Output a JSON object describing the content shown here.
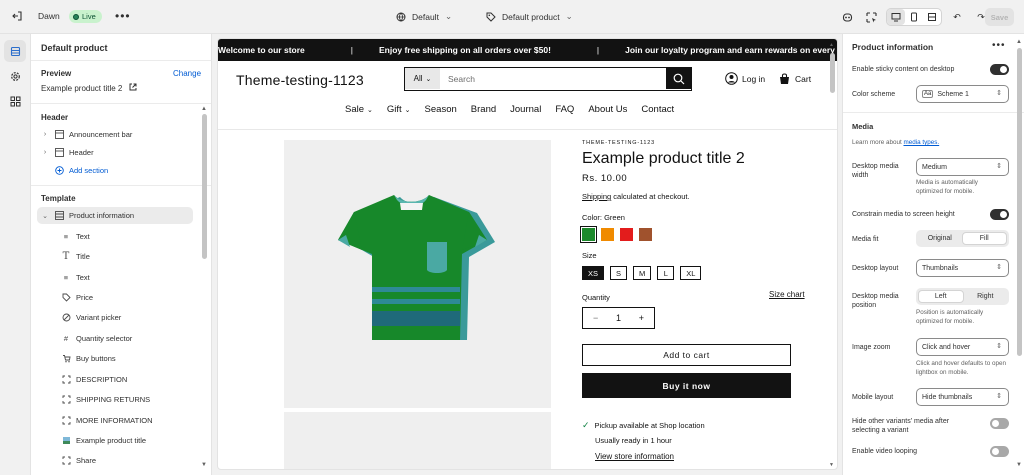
{
  "topbar": {
    "theme_name": "Dawn",
    "live_label": "Live",
    "more": "•••",
    "template_select": "Default",
    "product_select": "Default product",
    "save_label": "Save"
  },
  "left_panel": {
    "title": "Default product",
    "preview_label": "Preview",
    "change_label": "Change",
    "preview_value": "Example product title 2",
    "header_section": "Header",
    "header_items": [
      "Announcement bar",
      "Header"
    ],
    "add_section": "Add section",
    "template_section": "Template",
    "template_item": "Product information",
    "blocks": [
      "Text",
      "Title",
      "Text",
      "Price",
      "Variant picker",
      "Quantity selector",
      "Buy buttons",
      "DESCRIPTION",
      "SHIPPING RETURNS",
      "MORE INFORMATION",
      "Example product title",
      "Share"
    ]
  },
  "store": {
    "announcements": [
      "Welcome to our store",
      "Enjoy free shipping on all orders over $50!",
      "Join our loyalty program and earn rewards on every"
    ],
    "name": "Theme-testing-1123",
    "search_category": "All",
    "search_placeholder": "Search",
    "login": "Log in",
    "cart": "Cart",
    "nav": [
      "Sale",
      "Gift",
      "Season",
      "Brand",
      "Journal",
      "FAQ",
      "About Us",
      "Contact"
    ]
  },
  "product": {
    "vendor": "THEME-TESTING-1123",
    "title": "Example product title 2",
    "price": "Rs. 10.00",
    "shipping_link": "Shipping",
    "shipping_text": " calculated at checkout.",
    "color_label": "Color: Green",
    "swatch_colors": [
      "#1c8a2c",
      "#f08a00",
      "#e31c1c",
      "#a0522d"
    ],
    "size_label": "Size",
    "sizes": [
      "XS",
      "S",
      "M",
      "L",
      "XL"
    ],
    "quantity_label": "Quantity",
    "size_chart": "Size chart",
    "quantity_minus": "−",
    "quantity_value": "1",
    "quantity_plus": "+",
    "add_to_cart": "Add to cart",
    "buy_now": "Buy it now",
    "pickup_text": "Pickup available at Shop location",
    "ready_text": "Usually ready in 1 hour",
    "store_info": "View store information"
  },
  "right_panel": {
    "title": "Product information",
    "sticky_label": "Enable sticky content on desktop",
    "color_scheme_label": "Color scheme",
    "color_scheme_value": "Scheme 1",
    "media_section": "Media",
    "media_learn": "Learn more about ",
    "media_link": "media types.",
    "desktop_media_width_label": "Desktop media width",
    "desktop_media_width_value": "Medium",
    "desktop_media_width_help": "Media is automatically optimized for mobile.",
    "constrain_label": "Constrain media to screen height",
    "media_fit_label": "Media fit",
    "media_fit_options": [
      "Original",
      "Fill"
    ],
    "desktop_layout_label": "Desktop layout",
    "desktop_layout_value": "Thumbnails",
    "desktop_media_position_label": "Desktop media position",
    "desktop_media_position_options": [
      "Left",
      "Right"
    ],
    "desktop_media_position_help": "Position is automatically optimized for mobile.",
    "image_zoom_label": "Image zoom",
    "image_zoom_value": "Click and hover",
    "image_zoom_help": "Click and hover defaults to open lightbox on mobile.",
    "mobile_layout_label": "Mobile layout",
    "mobile_layout_value": "Hide thumbnails",
    "hide_variants_label": "Hide other variants' media after selecting a variant",
    "video_looping_label": "Enable video looping"
  }
}
